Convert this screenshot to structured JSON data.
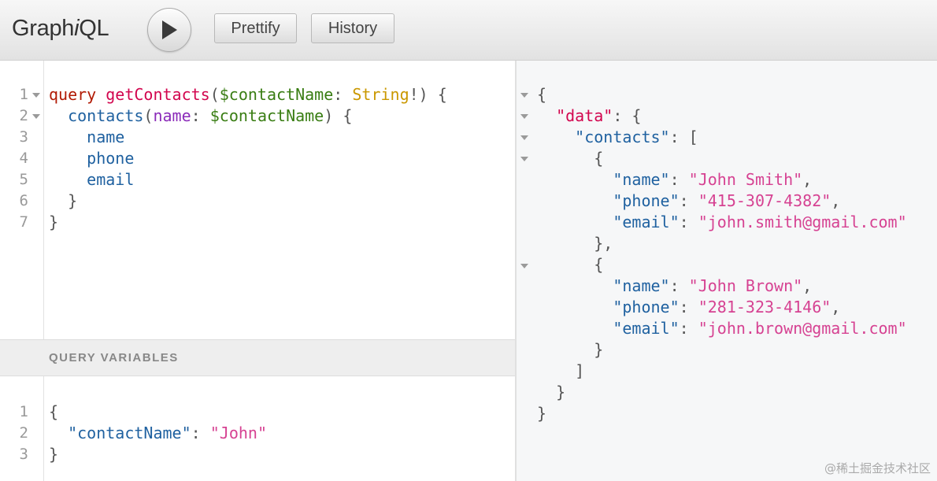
{
  "toolbar": {
    "brand_prefix": "Graph",
    "brand_i": "i",
    "brand_suffix": "QL",
    "execute_icon": "play-icon",
    "prettify_label": "Prettify",
    "history_label": "History"
  },
  "query_editor": {
    "line_numbers": [
      "1",
      "2",
      "3",
      "4",
      "5",
      "6",
      "7"
    ],
    "lines": [
      [
        {
          "t": "query",
          "c": "kw"
        },
        {
          "t": " ",
          "c": "pun"
        },
        {
          "t": "getContacts",
          "c": "def"
        },
        {
          "t": "(",
          "c": "pun"
        },
        {
          "t": "$contactName",
          "c": "var"
        },
        {
          "t": ": ",
          "c": "pun"
        },
        {
          "t": "String",
          "c": "typ"
        },
        {
          "t": "!) {",
          "c": "pun"
        }
      ],
      [
        {
          "t": "  ",
          "c": "pun"
        },
        {
          "t": "contacts",
          "c": "fld"
        },
        {
          "t": "(",
          "c": "pun"
        },
        {
          "t": "name",
          "c": "att"
        },
        {
          "t": ": ",
          "c": "pun"
        },
        {
          "t": "$contactName",
          "c": "var"
        },
        {
          "t": ") {",
          "c": "pun"
        }
      ],
      [
        {
          "t": "    ",
          "c": "pun"
        },
        {
          "t": "name",
          "c": "fld"
        }
      ],
      [
        {
          "t": "    ",
          "c": "pun"
        },
        {
          "t": "phone",
          "c": "fld"
        }
      ],
      [
        {
          "t": "    ",
          "c": "pun"
        },
        {
          "t": "email",
          "c": "fld"
        }
      ],
      [
        {
          "t": "  }",
          "c": "pun"
        }
      ],
      [
        {
          "t": "}",
          "c": "pun"
        }
      ]
    ]
  },
  "variables": {
    "title": "QUERY VARIABLES",
    "line_numbers": [
      "1",
      "2",
      "3"
    ],
    "lines": [
      [
        {
          "t": "{",
          "c": "pun"
        }
      ],
      [
        {
          "t": "  ",
          "c": "pun"
        },
        {
          "t": "\"contactName\"",
          "c": "prop"
        },
        {
          "t": ": ",
          "c": "pun"
        },
        {
          "t": "\"John\"",
          "c": "str"
        }
      ],
      [
        {
          "t": "}",
          "c": "pun"
        }
      ]
    ]
  },
  "result": {
    "lines": [
      [
        {
          "t": "{",
          "c": "pun"
        }
      ],
      [
        {
          "t": "  ",
          "c": "pun"
        },
        {
          "t": "\"data\"",
          "c": "def"
        },
        {
          "t": ": {",
          "c": "pun"
        }
      ],
      [
        {
          "t": "    ",
          "c": "pun"
        },
        {
          "t": "\"contacts\"",
          "c": "prop"
        },
        {
          "t": ": [",
          "c": "pun"
        }
      ],
      [
        {
          "t": "      {",
          "c": "pun"
        }
      ],
      [
        {
          "t": "        ",
          "c": "pun"
        },
        {
          "t": "\"name\"",
          "c": "prop"
        },
        {
          "t": ": ",
          "c": "pun"
        },
        {
          "t": "\"John Smith\"",
          "c": "str"
        },
        {
          "t": ",",
          "c": "pun"
        }
      ],
      [
        {
          "t": "        ",
          "c": "pun"
        },
        {
          "t": "\"phone\"",
          "c": "prop"
        },
        {
          "t": ": ",
          "c": "pun"
        },
        {
          "t": "\"415-307-4382\"",
          "c": "str"
        },
        {
          "t": ",",
          "c": "pun"
        }
      ],
      [
        {
          "t": "        ",
          "c": "pun"
        },
        {
          "t": "\"email\"",
          "c": "prop"
        },
        {
          "t": ": ",
          "c": "pun"
        },
        {
          "t": "\"john.smith@gmail.com\"",
          "c": "str"
        }
      ],
      [
        {
          "t": "      },",
          "c": "pun"
        }
      ],
      [
        {
          "t": "      {",
          "c": "pun"
        }
      ],
      [
        {
          "t": "        ",
          "c": "pun"
        },
        {
          "t": "\"name\"",
          "c": "prop"
        },
        {
          "t": ": ",
          "c": "pun"
        },
        {
          "t": "\"John Brown\"",
          "c": "str"
        },
        {
          "t": ",",
          "c": "pun"
        }
      ],
      [
        {
          "t": "        ",
          "c": "pun"
        },
        {
          "t": "\"phone\"",
          "c": "prop"
        },
        {
          "t": ": ",
          "c": "pun"
        },
        {
          "t": "\"281-323-4146\"",
          "c": "str"
        },
        {
          "t": ",",
          "c": "pun"
        }
      ],
      [
        {
          "t": "        ",
          "c": "pun"
        },
        {
          "t": "\"email\"",
          "c": "prop"
        },
        {
          "t": ": ",
          "c": "pun"
        },
        {
          "t": "\"john.brown@gmail.com\"",
          "c": "str"
        }
      ],
      [
        {
          "t": "      }",
          "c": "pun"
        }
      ],
      [
        {
          "t": "    ]",
          "c": "pun"
        }
      ],
      [
        {
          "t": "  }",
          "c": "pun"
        }
      ],
      [
        {
          "t": "}",
          "c": "pun"
        }
      ]
    ]
  },
  "watermark": "@稀土掘金技术社区",
  "colors": {
    "keyword": "#b11a04",
    "definition": "#d2054e",
    "variable": "#397d13",
    "field": "#1f61a0",
    "argument": "#8b2bb9",
    "type": "#ca9800",
    "string": "#d64292"
  }
}
